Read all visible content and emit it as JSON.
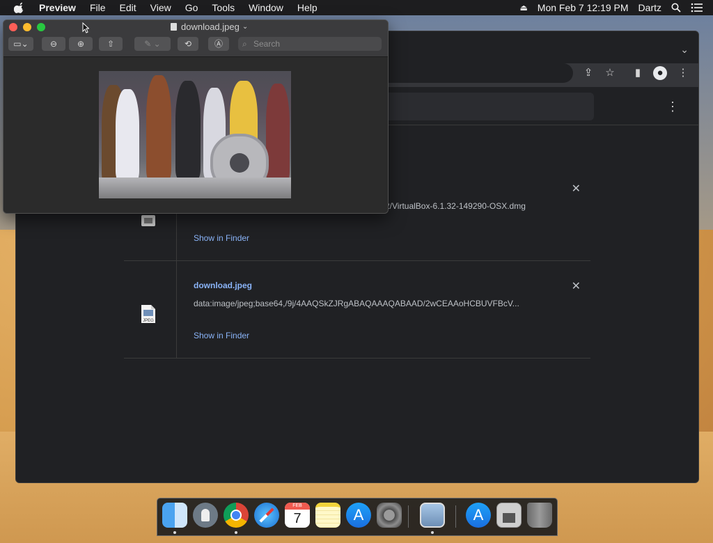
{
  "menubar": {
    "app": "Preview",
    "menus": [
      "File",
      "Edit",
      "View",
      "Go",
      "Tools",
      "Window",
      "Help"
    ],
    "clock": "Mon Feb 7  12:19 PM",
    "user": "Dartz"
  },
  "preview": {
    "title": "download.jpeg",
    "search_placeholder": "Search",
    "image_alt": "Group photo of costumed mascots (image content)"
  },
  "chrome": {
    "downloads": [
      {
        "name": "",
        "url": "2/VirtualBox-6.1.32-149290-OSX.dmg",
        "show_in_finder": "Show in Finder"
      },
      {
        "name": "download.jpeg",
        "url": "data:image/jpeg;base64,/9j/4AAQSkZJRgABAQAAAQABAAD/2wCEAAoHCBUVFBcV...",
        "show_in_finder": "Show in Finder",
        "icon_label": "JPEG"
      }
    ]
  },
  "dock": {
    "items": [
      "finder-icon",
      "launchpad-icon",
      "chrome-icon",
      "safari-icon",
      "calendar-icon",
      "notes-icon",
      "app-store-icon",
      "system-preferences-icon",
      "preview-icon",
      "app-store-icon",
      "documents-folder-icon",
      "trash-icon"
    ],
    "calendar_month": "FEB",
    "calendar_day": "7"
  },
  "colors": {
    "link": "#8ab4f8",
    "chrome_bg": "#202124",
    "menubar_bg": "#1d1d1f"
  }
}
